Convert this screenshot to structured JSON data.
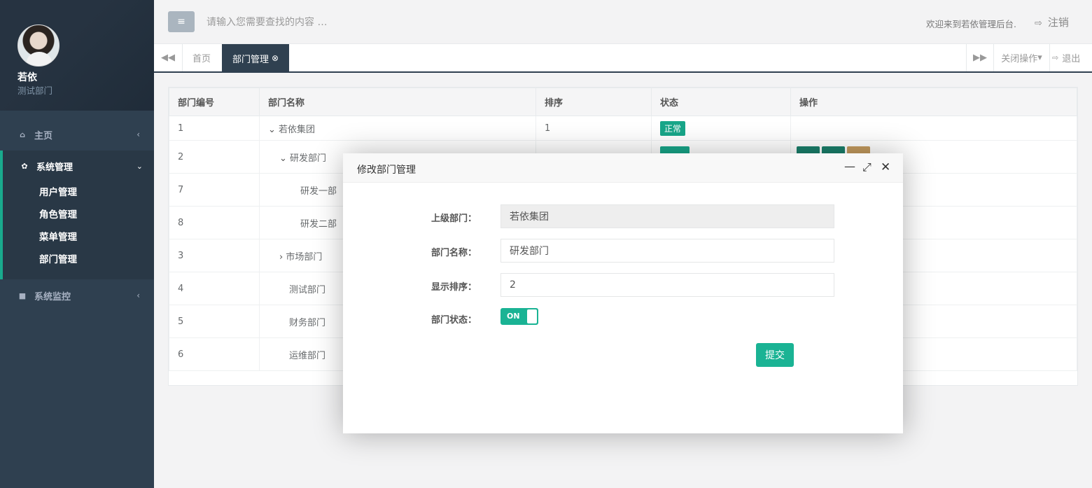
{
  "user": {
    "name": "若依",
    "dept": "测试部门"
  },
  "sidebar": {
    "home": {
      "label": "主页",
      "icon": "home-icon"
    },
    "system": {
      "label": "系统管理",
      "icon": "gear-icon",
      "items": [
        {
          "label": "用户管理"
        },
        {
          "label": "角色管理"
        },
        {
          "label": "菜单管理"
        },
        {
          "label": "部门管理"
        }
      ]
    },
    "monitor": {
      "label": "系统监控",
      "icon": "camera-icon"
    }
  },
  "topbar": {
    "search_placeholder": "请输入您需要查找的内容 …",
    "welcome": "欢迎来到若依管理后台.",
    "logout": "注销"
  },
  "tabs": {
    "home": "首页",
    "active": "部门管理",
    "close_ops": "关闭操作",
    "exit": "退出"
  },
  "table": {
    "headers": [
      "部门编号",
      "部门名称",
      "排序",
      "状态",
      "操作"
    ],
    "rows": [
      {
        "id": "1",
        "name": "若依集团",
        "order": "1",
        "status": "正常"
      },
      {
        "id": "2",
        "name": "研发部门"
      },
      {
        "id": "7",
        "name": "研发一部"
      },
      {
        "id": "8",
        "name": "研发二部"
      },
      {
        "id": "3",
        "name": "市场部门"
      },
      {
        "id": "4",
        "name": "测试部门"
      },
      {
        "id": "5",
        "name": "财务部门"
      },
      {
        "id": "6",
        "name": "运维部门"
      }
    ]
  },
  "modal": {
    "title": "修改部门管理",
    "fields": {
      "parent": {
        "label": "上级部门：",
        "value": "若依集团"
      },
      "name": {
        "label": "部门名称：",
        "value": "研发部门"
      },
      "order": {
        "label": "显示排序：",
        "value": "2"
      },
      "status": {
        "label": "部门状态：",
        "toggle": "ON",
        "checked": true
      }
    },
    "submit": "提交"
  },
  "colors": {
    "sidebar": "#2f4050",
    "accent": "#1ab394",
    "tab_active": "#2f4050"
  }
}
